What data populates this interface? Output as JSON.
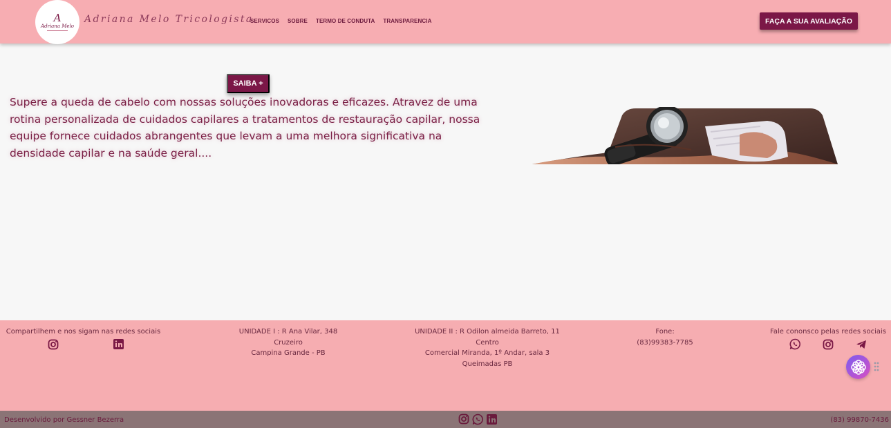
{
  "header": {
    "logo": {
      "monogram": "A",
      "name": "Adriana Melo"
    },
    "brand": "Adriana Melo Tricologista",
    "nav": [
      "SERVICOS",
      "SOBRE",
      "TERMO DE CONDUTA",
      "TRANSPARENCIA"
    ],
    "cta_label": "FAÇA A SUA AVALIAÇÃO"
  },
  "hero": {
    "button_label": "SAIBA +",
    "text": "Supere a queda de cabelo com nossas soluções inovadoras e eficazes. Atravez de uma rotina personalizada de cuidados capilares a tratamentos de restauração capilar, nossa equipe fornece cuidados abrangentes que levam a uma melhora significativa na densidade capilar e na saúde geral...."
  },
  "footer": {
    "share": {
      "title": "Compartilhem e nos sigam nas redes sociais",
      "icons": [
        "instagram-icon",
        "linkedin-icon"
      ]
    },
    "unit1": {
      "line1": "UNIDADE I : R Ana Vilar, 348",
      "line2": "Cruzeiro",
      "line3": "Campina Grande - PB"
    },
    "unit2": {
      "line1": "UNIDADE II : R Odilon almeida Barreto, 11",
      "line2": "Centro",
      "line3": "Comercial Miranda, 1º Andar, sala 3",
      "line4": "Queimadas PB"
    },
    "phone": {
      "label": "Fone:",
      "number": "(83)99383-7785"
    },
    "contact": {
      "title": "Fale cononsco pelas redes sociais",
      "icons": [
        "whatsapp-icon",
        "instagram-icon",
        "telegram-icon"
      ]
    }
  },
  "bottombar": {
    "credit": "Desenvolvido por Gessner Bezerra",
    "phone": "(83) 99870-7436",
    "icons": [
      "instagram-icon",
      "whatsapp-icon",
      "linkedin-icon"
    ]
  },
  "colors": {
    "header_bg": "#f7adb2",
    "accent": "#7b1747",
    "footer_bg": "#f6adb1",
    "bottombar_bg": "#8b7476",
    "text": "#7a1f45"
  }
}
